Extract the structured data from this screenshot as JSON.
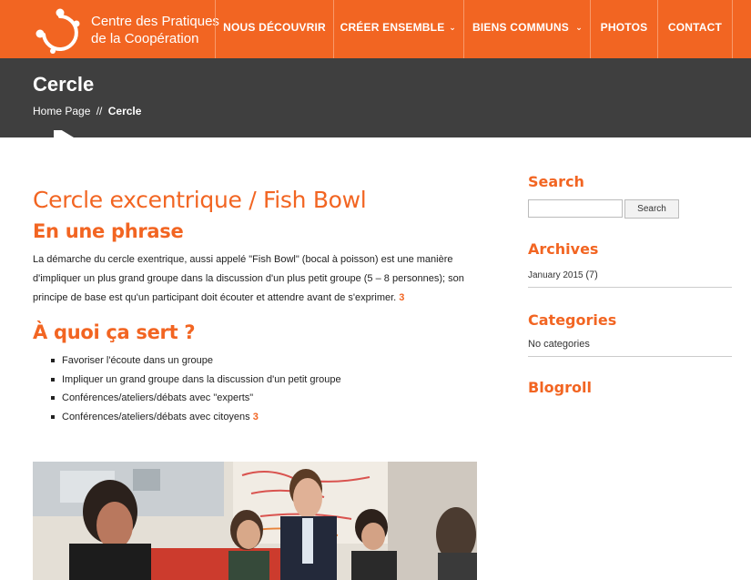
{
  "header": {
    "logo_line1": "Centre des Pratiques",
    "logo_line2": "de la Coopération",
    "nav": [
      {
        "label": "NOUS DÉCOUVRIR",
        "has_dropdown": false
      },
      {
        "label": "CRÉER ENSEMBLE",
        "has_dropdown": true
      },
      {
        "label": "BIENS COMMUNS",
        "has_dropdown": true
      },
      {
        "label": "PHOTOS",
        "has_dropdown": false
      },
      {
        "label": "CONTACT",
        "has_dropdown": false
      }
    ],
    "brand_color": "#f26522"
  },
  "title_band": {
    "title": "Cercle",
    "breadcrumb_home": "Home Page",
    "breadcrumb_sep": "//",
    "breadcrumb_current": "Cercle"
  },
  "article": {
    "title": "Cercle excentrique / Fish Bowl",
    "section1_heading": "En une phrase",
    "section1_text": "La démarche du cercle exentrique, aussi appelé \"Fish Bowl\" (bocal à poisson) est une manière d'impliquer un plus grand groupe dans la discussion d'un plus petit groupe (5 – 8 personnes); son principe de base est qu'un participant doit écouter et attendre avant de s'exprimer.",
    "section1_ref": "3",
    "section2_heading": "À quoi ça sert ?",
    "bullets": [
      "Favoriser l'écoute dans un groupe",
      "Impliquer un grand groupe dans la discussion d'un petit groupe",
      "Conférences/ateliers/débats avec \"experts\"",
      "Conférences/ateliers/débats avec citoyens"
    ],
    "bullet4_ref": "3"
  },
  "sidebar": {
    "search_heading": "Search",
    "search_value": "",
    "search_button": "Search",
    "archives_heading": "Archives",
    "archive_month": "January 2015",
    "archive_count": "(7)",
    "categories_heading": "Categories",
    "categories_empty": "No categories",
    "blogroll_heading": "Blogroll"
  }
}
